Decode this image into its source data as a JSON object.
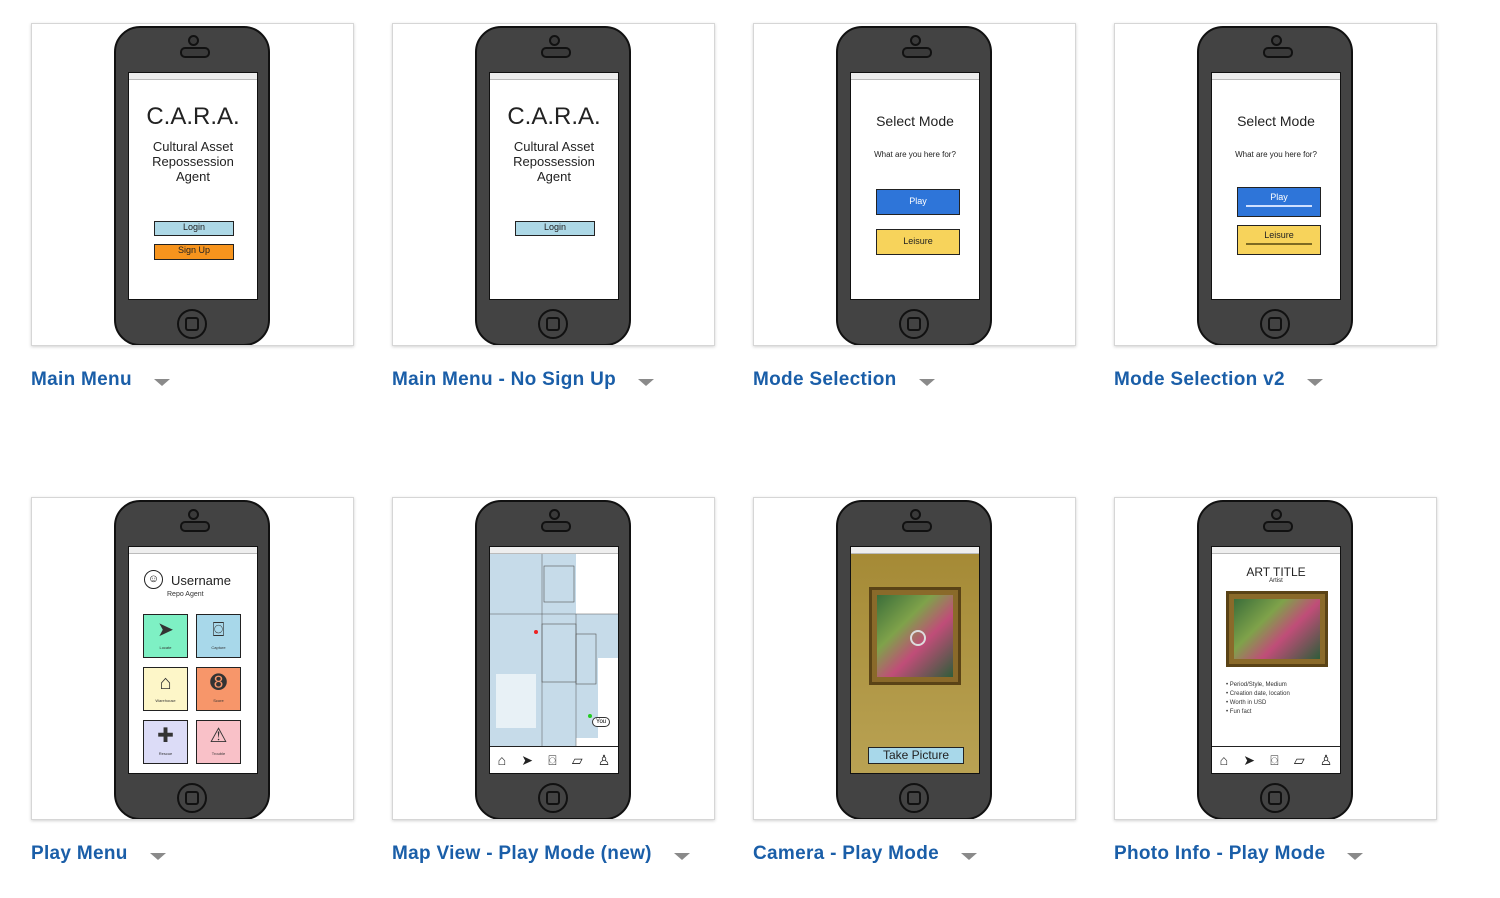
{
  "cards": [
    {
      "title": "Main Menu",
      "screen": {
        "logo": "C.A.R.A.",
        "subtitle_lines": [
          "Cultural Asset",
          "Repossession",
          "Agent"
        ],
        "login": "Login",
        "signup": "Sign Up"
      }
    },
    {
      "title": "Main Menu - No Sign Up",
      "screen": {
        "logo": "C.A.R.A.",
        "subtitle_lines": [
          "Cultural Asset",
          "Repossession",
          "Agent"
        ],
        "login": "Login"
      }
    },
    {
      "title": "Mode Selection",
      "screen": {
        "heading": "Select Mode",
        "question": "What are you here for?",
        "play": "Play",
        "leisure": "Leisure"
      }
    },
    {
      "title": "Mode Selection v2",
      "screen": {
        "heading": "Select Mode",
        "question": "What are you here for?",
        "play": "Play",
        "leisure": "Leisure"
      }
    },
    {
      "title": "Play Menu",
      "screen": {
        "username": "Username",
        "rank": "Repo Agent",
        "tiles": [
          "Locate",
          "Capture",
          "Warehouse",
          "Score",
          "Rescue",
          "Trouble"
        ]
      }
    },
    {
      "title": "Map View - Play Mode (new)",
      "screen": {
        "you_label": "You"
      }
    },
    {
      "title": "Camera - Play Mode",
      "screen": {
        "button": "Take Picture"
      }
    },
    {
      "title": "Photo Info - Play Mode",
      "screen": {
        "art_title": "ART TITLE",
        "artist": "Artist",
        "facts": [
          "Period/Style, Medium",
          "Creation date, location",
          "Worth in USD",
          "Fun fact"
        ]
      }
    }
  ],
  "icons": {
    "caret": "chevron-down-icon",
    "tabbar": [
      "home-icon",
      "locate-icon",
      "camera-icon",
      "folder-icon",
      "user-icon"
    ]
  },
  "colors": {
    "link": "#1a5ea8",
    "login_btn": "#add8e6",
    "signup_btn": "#f7941d",
    "play_btn": "#2e75d9",
    "leisure_btn": "#f7d35b"
  }
}
